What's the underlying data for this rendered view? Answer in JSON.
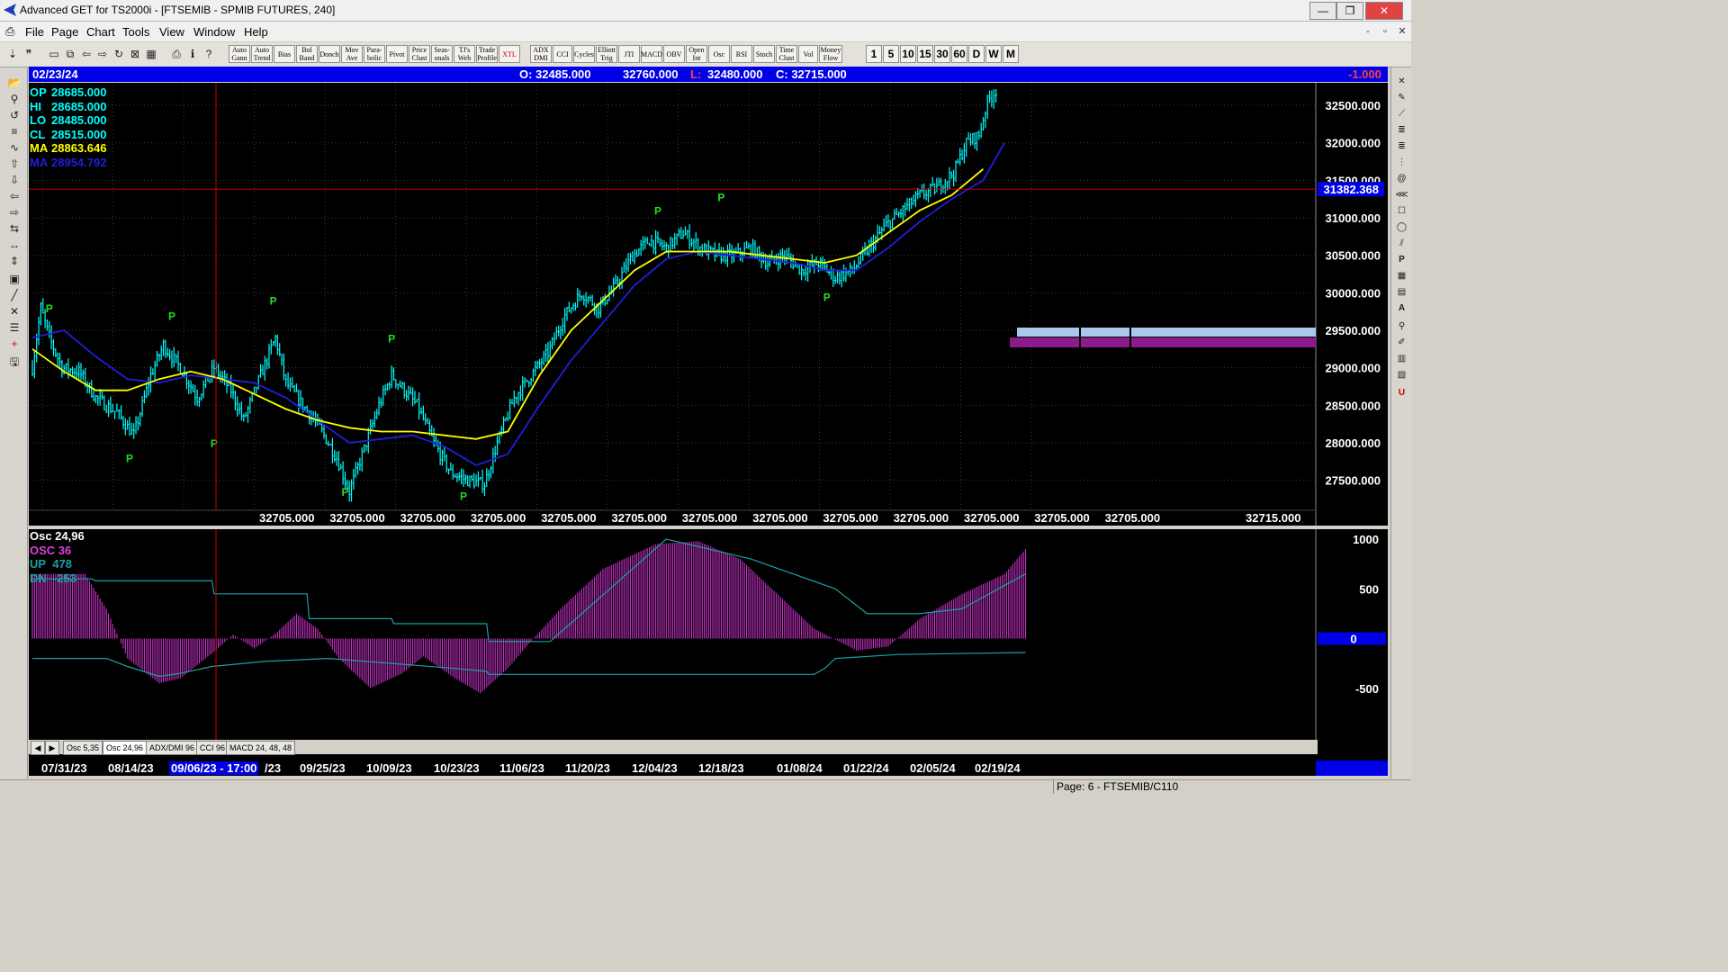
{
  "window": {
    "title": "Advanced GET for TS2000i - [FTSEMIB - SPMIB FUTURES, 240]",
    "min_glyph": "—",
    "max_glyph": "❐",
    "close_glyph": "✕",
    "mdi_min": "-",
    "mdi_restore": "▫",
    "mdi_close": "✕"
  },
  "menu": [
    "File",
    "Page",
    "Chart",
    "Tools",
    "View",
    "Window",
    "Help"
  ],
  "toolbar": {
    "indicator_buttons": [
      "Auto Gann",
      "Auto Trend",
      "Bias",
      "Bol Band",
      "Donch",
      "Mov Ave",
      "Para-bolic",
      "Pivot",
      "Price Clust",
      "Seas-onals",
      "TJ's Web",
      "Trade Profile",
      "XTL",
      "ADX DMI",
      "CCI",
      "Cycles",
      "Elliott Trig",
      "JTI",
      "MACD",
      "OBV",
      "Open Int",
      "Osc",
      "RSI",
      "Stoch",
      "Time Clust",
      "Vol",
      "Money Flow"
    ],
    "interval_buttons": [
      "1",
      "5",
      "10",
      "15",
      "30",
      "60",
      "D",
      "W",
      "M"
    ]
  },
  "infobar": {
    "date": "02/23/24",
    "open": "O: 32485.000",
    "high": "32760.000",
    "low_label": "L:",
    "low": "32480.000",
    "close": "C: 32715.000",
    "change": "-1.000"
  },
  "price_legend": [
    {
      "label": "OP",
      "value": "28685.000",
      "color": "#00ffff"
    },
    {
      "label": "HI",
      "value": "28685.000",
      "color": "#00ffff"
    },
    {
      "label": "LO",
      "value": "28485.000",
      "color": "#00ffff"
    },
    {
      "label": "CL",
      "value": "28515.000",
      "color": "#00ffff"
    },
    {
      "label": "MA",
      "value": "28863.646",
      "color": "#ffff00"
    },
    {
      "label": "MA",
      "value": "28954.792",
      "color": "#1f1fd8"
    }
  ],
  "cursor_price": "31382.368",
  "bottom_price_labels": [
    "32705.000",
    "32705.000",
    "32705.000",
    "32705.000",
    "32705.000",
    "32705.000",
    "32705.000",
    "32705.000",
    "32705.000",
    "32705.000",
    "32705.000",
    "32705.000",
    "32705.000",
    "32715.000"
  ],
  "osc_legend": {
    "title": "Osc 24,96",
    "osc": "OSC 36",
    "up_label": "UP",
    "up_value": "478",
    "dn_label": "DN",
    "dn_value": "-253"
  },
  "tabs": [
    "Osc 5,35",
    "Osc 24,96",
    "ADX/DMI 96",
    "CCI 96",
    "MACD 24, 48, 48"
  ],
  "active_tab": "Osc 24,96",
  "date_axis": [
    "07/31/23",
    "08/14/23",
    "09/06/23 - 17:00",
    "/23",
    "09/25/23",
    "10/09/23",
    "10/23/23",
    "11/06/23",
    "11/20/23",
    "12/04/23",
    "12/18/23",
    "01/08/24",
    "01/22/24",
    "02/05/24",
    "02/19/24"
  ],
  "highlighted_date": "09/06/23 - 17:00",
  "status": "Page: 6 - FTSEMIB/C110",
  "colors": {
    "price_bars": "#00ffff",
    "ma_fast": "#ffff00",
    "ma_slow": "#1f1fd8",
    "pivot": "#22dd22",
    "osc": "#cc33cc",
    "bands": "#1aa0a0",
    "cursor": "#cc0000",
    "axis_bar": "#0000e6"
  },
  "chart_data": [
    {
      "type": "line",
      "title": "FTSEMIB - SPMIB FUTURES, 240",
      "x_dates": [
        "07/31/23",
        "08/14/23",
        "09/06/23",
        "09/25/23",
        "10/09/23",
        "10/23/23",
        "11/06/23",
        "11/20/23",
        "12/04/23",
        "12/18/23",
        "01/08/24",
        "01/22/24",
        "02/05/24",
        "02/19/24"
      ],
      "ylim": [
        27100,
        32800
      ],
      "yticks": [
        27500,
        28000,
        28500,
        29000,
        29500,
        30000,
        30500,
        31000,
        31500,
        32000,
        32500
      ],
      "series": [
        {
          "name": "price",
          "points": [
            [
              0,
              29000
            ],
            [
              4,
              29800
            ],
            [
              8,
              29400
            ],
            [
              14,
              29000
            ],
            [
              22,
              28950
            ],
            [
              30,
              28600
            ],
            [
              40,
              28400
            ],
            [
              48,
              28100
            ],
            [
              56,
              28900
            ],
            [
              62,
              29300
            ],
            [
              70,
              29000
            ],
            [
              78,
              28600
            ],
            [
              86,
              29000
            ],
            [
              94,
              28700
            ],
            [
              100,
              28300
            ],
            [
              108,
              28900
            ],
            [
              115,
              29400
            ],
            [
              120,
              28800
            ],
            [
              128,
              28500
            ],
            [
              136,
              28200
            ],
            [
              144,
              27800
            ],
            [
              150,
              27350
            ],
            [
              158,
              28000
            ],
            [
              164,
              28500
            ],
            [
              170,
              28900
            ],
            [
              176,
              28700
            ],
            [
              182,
              28500
            ],
            [
              190,
              28000
            ],
            [
              198,
              27600
            ],
            [
              206,
              27500
            ],
            [
              214,
              27450
            ],
            [
              220,
              28000
            ],
            [
              228,
              28600
            ],
            [
              236,
              28900
            ],
            [
              244,
              29200
            ],
            [
              252,
              29700
            ],
            [
              260,
              30000
            ],
            [
              268,
              29800
            ],
            [
              276,
              30100
            ],
            [
              284,
              30500
            ],
            [
              292,
              30700
            ],
            [
              300,
              30600
            ],
            [
              308,
              30800
            ],
            [
              316,
              30600
            ],
            [
              324,
              30500
            ],
            [
              332,
              30500
            ],
            [
              340,
              30600
            ],
            [
              348,
              30400
            ],
            [
              356,
              30500
            ],
            [
              364,
              30300
            ],
            [
              372,
              30400
            ],
            [
              380,
              30200
            ],
            [
              388,
              30300
            ],
            [
              396,
              30600
            ],
            [
              404,
              30900
            ],
            [
              412,
              31100
            ],
            [
              420,
              31300
            ],
            [
              428,
              31400
            ],
            [
              436,
              31600
            ],
            [
              442,
              32000
            ],
            [
              448,
              32100
            ],
            [
              452,
              32550
            ],
            [
              456,
              32700
            ]
          ]
        },
        {
          "name": "MA",
          "points": [
            [
              0,
              29250
            ],
            [
              15,
              28950
            ],
            [
              30,
              28700
            ],
            [
              45,
              28700
            ],
            [
              60,
              28850
            ],
            [
              75,
              28950
            ],
            [
              90,
              28850
            ],
            [
              105,
              28650
            ],
            [
              120,
              28450
            ],
            [
              135,
              28300
            ],
            [
              150,
              28200
            ],
            [
              165,
              28150
            ],
            [
              180,
              28150
            ],
            [
              195,
              28100
            ],
            [
              210,
              28050
            ],
            [
              225,
              28150
            ],
            [
              240,
              28900
            ],
            [
              255,
              29500
            ],
            [
              270,
              29900
            ],
            [
              285,
              30300
            ],
            [
              300,
              30550
            ],
            [
              315,
              30550
            ],
            [
              330,
              30550
            ],
            [
              345,
              30500
            ],
            [
              360,
              30450
            ],
            [
              375,
              30400
            ],
            [
              390,
              30500
            ],
            [
              405,
              30800
            ],
            [
              420,
              31100
            ],
            [
              435,
              31300
            ],
            [
              450,
              31650
            ]
          ]
        },
        {
          "name": "MA2",
          "points": [
            [
              0,
              29400
            ],
            [
              15,
              29500
            ],
            [
              30,
              29150
            ],
            [
              45,
              28850
            ],
            [
              60,
              28800
            ],
            [
              75,
              28900
            ],
            [
              90,
              28850
            ],
            [
              105,
              28800
            ],
            [
              120,
              28600
            ],
            [
              135,
              28300
            ],
            [
              150,
              28000
            ],
            [
              165,
              28050
            ],
            [
              180,
              28100
            ],
            [
              195,
              27950
            ],
            [
              210,
              27700
            ],
            [
              225,
              27850
            ],
            [
              240,
              28500
            ],
            [
              255,
              29100
            ],
            [
              270,
              29600
            ],
            [
              285,
              30100
            ],
            [
              300,
              30450
            ],
            [
              315,
              30550
            ],
            [
              330,
              30500
            ],
            [
              345,
              30450
            ],
            [
              360,
              30400
            ],
            [
              375,
              30300
            ],
            [
              390,
              30300
            ],
            [
              405,
              30600
            ],
            [
              420,
              30950
            ],
            [
              435,
              31250
            ],
            [
              450,
              31500
            ],
            [
              460,
              32000
            ]
          ]
        }
      ],
      "pivots": [
        [
          8,
          29800,
          "P"
        ],
        [
          46,
          27800,
          "P"
        ],
        [
          66,
          29700,
          "P"
        ],
        [
          86,
          28000,
          "P"
        ],
        [
          114,
          29900,
          "P"
        ],
        [
          148,
          27350,
          "P"
        ],
        [
          170,
          29400,
          "P"
        ],
        [
          204,
          27300,
          "P"
        ],
        [
          296,
          31100,
          "P"
        ],
        [
          326,
          31280,
          "P"
        ],
        [
          376,
          29950,
          "P"
        ]
      ]
    },
    {
      "type": "bar",
      "title": "Osc 24,96",
      "ylim": [
        -1000,
        1100
      ],
      "yticks": [
        -500,
        0,
        500,
        1000
      ],
      "series": [
        {
          "name": "OSC 36",
          "points": [
            [
              0,
              650
            ],
            [
              25,
              650
            ],
            [
              35,
              300
            ],
            [
              45,
              -200
            ],
            [
              60,
              -450
            ],
            [
              70,
              -400
            ],
            [
              85,
              -150
            ],
            [
              95,
              40
            ],
            [
              105,
              -100
            ],
            [
              115,
              50
            ],
            [
              125,
              250
            ],
            [
              135,
              100
            ],
            [
              145,
              -200
            ],
            [
              160,
              -500
            ],
            [
              175,
              -350
            ],
            [
              185,
              -180
            ],
            [
              200,
              -400
            ],
            [
              212,
              -550
            ],
            [
              225,
              -300
            ],
            [
              235,
              -50
            ],
            [
              250,
              300
            ],
            [
              270,
              700
            ],
            [
              295,
              950
            ],
            [
              315,
              980
            ],
            [
              335,
              800
            ],
            [
              355,
              400
            ],
            [
              370,
              100
            ],
            [
              390,
              -120
            ],
            [
              405,
              -80
            ],
            [
              420,
              200
            ],
            [
              440,
              450
            ],
            [
              460,
              650
            ],
            [
              470,
              900
            ]
          ]
        },
        {
          "name": "UP",
          "points": [
            [
              0,
              600
            ],
            [
              28,
              600
            ],
            [
              30,
              580
            ],
            [
              85,
              580
            ],
            [
              86,
              450
            ],
            [
              130,
              450
            ],
            [
              131,
              200
            ],
            [
              170,
              200
            ],
            [
              171,
              150
            ],
            [
              215,
              150
            ],
            [
              216,
              -30
            ],
            [
              245,
              -30
            ],
            [
              300,
              1000
            ],
            [
              340,
              800
            ],
            [
              380,
              500
            ],
            [
              395,
              250
            ],
            [
              420,
              250
            ],
            [
              440,
              300
            ],
            [
              470,
              650
            ]
          ]
        },
        {
          "name": "DN",
          "points": [
            [
              0,
              -200
            ],
            [
              35,
              -200
            ],
            [
              45,
              -280
            ],
            [
              60,
              -380
            ],
            [
              70,
              -350
            ],
            [
              85,
              -280
            ],
            [
              110,
              -230
            ],
            [
              140,
              -200
            ],
            [
              200,
              -300
            ],
            [
              215,
              -330
            ],
            [
              216,
              -360
            ],
            [
              370,
              -360
            ],
            [
              375,
              -300
            ],
            [
              380,
              -200
            ],
            [
              410,
              -160
            ],
            [
              470,
              -140
            ]
          ]
        }
      ]
    }
  ]
}
